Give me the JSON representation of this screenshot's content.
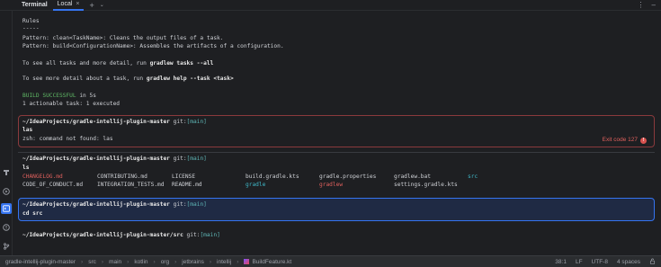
{
  "header": {
    "tool_title": "Terminal",
    "tab_label": "Local",
    "tab_close": "×",
    "add_icon": "+",
    "chevron_icon": "⌄",
    "more_icon": "⋮",
    "minimize_icon": "–"
  },
  "terminal": {
    "help_lines": [
      "Rules",
      "-----",
      "Pattern: clean<TaskName>: Cleans the output files of a task.",
      "Pattern: build<ConfigurationName>: Assembles the artifacts of a configuration."
    ],
    "tasks_hint_prefix": "To see all tasks and more detail, run ",
    "tasks_hint_cmd": "gradlew tasks --all",
    "task_hint_prefix": "To see more detail about a task, run ",
    "task_hint_cmd": "gradlew help --task <task>",
    "build_status": "BUILD SUCCESSFUL",
    "build_time": " in 5s",
    "actionable": "1 actionable task: 1 executed",
    "prompt_path": "~/IdeaProjects/gradle-intellij-plugin-master ",
    "prompt_path_src": "~/IdeaProjects/gradle-intellij-plugin-master/src ",
    "git_label": "git:",
    "git_branch": "[main]",
    "cmd_las": "las",
    "err_las": "zsh: command not found: las",
    "exit_code": "Exit code 127",
    "exit_icon": "!",
    "cmd_ls": "ls",
    "cmd_cd": "cd src",
    "ls_output": [
      {
        "text": "CHANGELOG.md",
        "color": "#e0605d"
      },
      {
        "text": "CONTRIBUTING.md",
        "color": "#cfd1d6"
      },
      {
        "text": "LICENSE",
        "color": "#cfd1d6"
      },
      {
        "text": "build.gradle.kts",
        "color": "#cfd1d6"
      },
      {
        "text": "gradle.properties",
        "color": "#cfd1d6"
      },
      {
        "text": "gradlew.bat",
        "color": "#cfd1d6"
      },
      {
        "text": "src",
        "color": "#3fb8c8"
      },
      {
        "text": "CODE_OF_CONDUCT.md",
        "color": "#cfd1d6"
      },
      {
        "text": "INTEGRATION_TESTS.md",
        "color": "#cfd1d6"
      },
      {
        "text": "README.md",
        "color": "#cfd1d6"
      },
      {
        "text": "gradle",
        "color": "#3fb8c8"
      },
      {
        "text": "gradlew",
        "color": "#e0605d"
      },
      {
        "text": "settings.gradle.kts",
        "color": "#cfd1d6"
      }
    ]
  },
  "sidebar": {
    "icons": [
      "build-icon",
      "run-icon",
      "terminal-icon",
      "problems-icon",
      "git-icon"
    ]
  },
  "statusbar": {
    "breadcrumbs": [
      "gradle-intellij-plugin-master",
      "src",
      "main",
      "kotlin",
      "org",
      "jetbrains",
      "intellij",
      "BuildFeature.kt"
    ],
    "position": "38:1",
    "line_sep": "LF",
    "encoding": "UTF-8",
    "indent": "4 spaces"
  },
  "colors": {
    "accent": "#3574f0",
    "error": "#e0605d",
    "success": "#5fb865",
    "branch": "#5fb8b8"
  }
}
